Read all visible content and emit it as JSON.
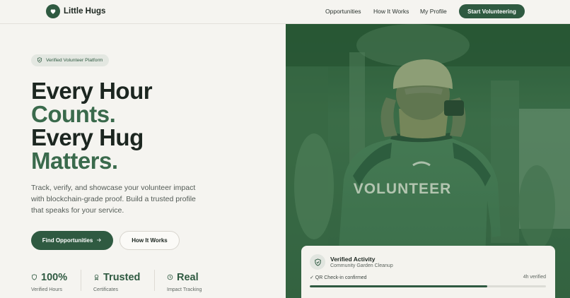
{
  "header": {
    "brand": "Little Hugs",
    "nav": [
      "Opportunities",
      "How It Works",
      "My Profile"
    ],
    "cta": "Start Volunteering"
  },
  "hero": {
    "badge": "Verified Volunteer Platform",
    "headline": {
      "line1": "Every Hour",
      "line2": "Counts.",
      "line3": "Every Hug",
      "line4": "Matters."
    },
    "description": "Track, verify, and showcase your volunteer impact with blockchain-grade proof. Build a trusted profile that speaks for your service.",
    "primary_button": "Find Opportunities",
    "secondary_button": "How It Works",
    "stats": [
      {
        "value": "100%",
        "label": "Verified Hours",
        "icon": "shield-icon"
      },
      {
        "value": "Trusted",
        "label": "Certificates",
        "icon": "award-icon"
      },
      {
        "value": "Real",
        "label": "Impact Tracking",
        "icon": "clock-icon"
      }
    ]
  },
  "photo": {
    "vest_text": "VOLUNTEER"
  },
  "card": {
    "title": "Verified Activity",
    "subtitle": "Community Garden Cleanup",
    "check": "✓ QR Check-in confirmed",
    "time": "4h verified",
    "progress": 0.75
  },
  "colors": {
    "brand": "#2f5a41",
    "accent": "#3a6a4c",
    "background": "#f5f4f0"
  }
}
